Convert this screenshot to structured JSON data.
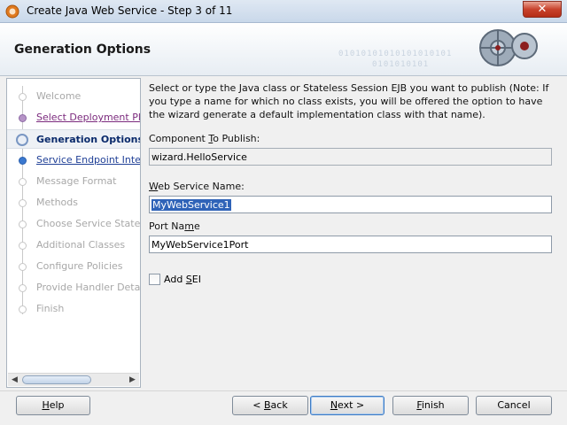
{
  "window": {
    "title": "Create Java Web Service - Step 3 of 11",
    "close_symbol": "✕",
    "app_icon": "java-web-service-icon"
  },
  "header": {
    "title": "Generation Options",
    "binary_line_1": "01010101010101010101",
    "binary_line_2": "0101010101"
  },
  "steps": [
    {
      "label": "Welcome",
      "state": "disabled"
    },
    {
      "label": "Select Deployment Platform",
      "state": "visited"
    },
    {
      "label": "Generation Options",
      "state": "current"
    },
    {
      "label": "Service Endpoint Interface",
      "state": "link"
    },
    {
      "label": "Message Format",
      "state": "disabled"
    },
    {
      "label": "Methods",
      "state": "disabled"
    },
    {
      "label": "Choose Service State",
      "state": "disabled"
    },
    {
      "label": "Additional Classes",
      "state": "disabled"
    },
    {
      "label": "Configure Policies",
      "state": "disabled"
    },
    {
      "label": "Provide Handler Details",
      "state": "disabled"
    },
    {
      "label": "Finish",
      "state": "disabled"
    }
  ],
  "content": {
    "intro": "Select or type the Java class or Stateless Session EJB you want to publish (Note: If you type a name for which no class exists, you will be offered the option to have the wizard generate a default implementation class with that name).",
    "component_label_pre": "Component ",
    "component_label_mnemonic": "T",
    "component_label_post": "o Publish:",
    "component_value": "wizard.HelloService",
    "ws_name_label_mnemonic": "W",
    "ws_name_label_post": "eb Service Name:",
    "ws_name_value": "MyWebService1",
    "port_label_pre": "Port Na",
    "port_label_mnemonic": "m",
    "port_label_post": "e",
    "port_value": "MyWebService1Port",
    "add_sei_label_pre": "Add ",
    "add_sei_label_mnemonic": "S",
    "add_sei_label_post": "EI",
    "add_sei_checked": false
  },
  "buttons": {
    "help_mnemonic": "H",
    "help_rest": "elp",
    "back_pre": "< ",
    "back_mnemonic": "B",
    "back_rest": "ack",
    "next_mnemonic": "N",
    "next_rest": "ext >",
    "finish_mnemonic": "F",
    "finish_rest": "inish",
    "cancel": "Cancel"
  },
  "colors": {
    "link": "#1f3f96",
    "visited": "#7b2a7d",
    "selection": "#2f63b8"
  }
}
